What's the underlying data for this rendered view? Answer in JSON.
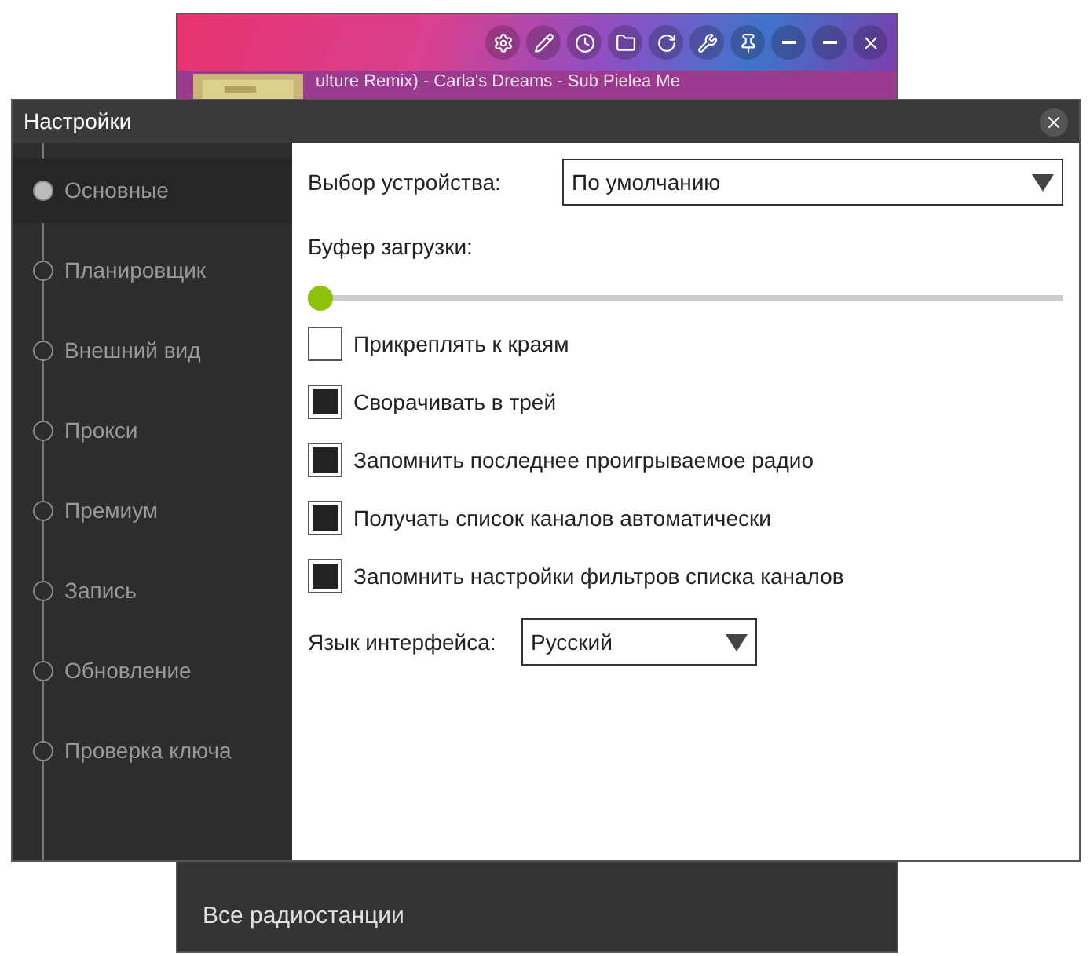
{
  "player": {
    "now_playing": "ulture Remix) - Carla's Dreams - Sub Pielea Me",
    "footer": "Все радиостанции"
  },
  "dialog": {
    "title": "Настройки",
    "sidebar": {
      "items": [
        {
          "label": "Основные",
          "selected": true
        },
        {
          "label": "Планировщик",
          "selected": false
        },
        {
          "label": "Внешний вид",
          "selected": false
        },
        {
          "label": "Прокси",
          "selected": false
        },
        {
          "label": "Премиум",
          "selected": false
        },
        {
          "label": "Запись",
          "selected": false
        },
        {
          "label": "Обновление",
          "selected": false
        },
        {
          "label": "Проверка ключа",
          "selected": false
        }
      ]
    },
    "device": {
      "label": "Выбор устройства:",
      "value": "По умолчанию"
    },
    "buffer": {
      "label": "Буфер загрузки:",
      "level": 0
    },
    "options": [
      {
        "label": "Прикреплять к краям",
        "checked": false
      },
      {
        "label": "Сворачивать в трей",
        "checked": true
      },
      {
        "label": "Запомнить последнее проигрываемое радио",
        "checked": true
      },
      {
        "label": "Получать список каналов автоматически",
        "checked": true
      },
      {
        "label": "Запомнить настройки фильтров списка каналов",
        "checked": true
      }
    ],
    "language": {
      "label": "Язык интерфейса:",
      "value": "Русский"
    }
  }
}
